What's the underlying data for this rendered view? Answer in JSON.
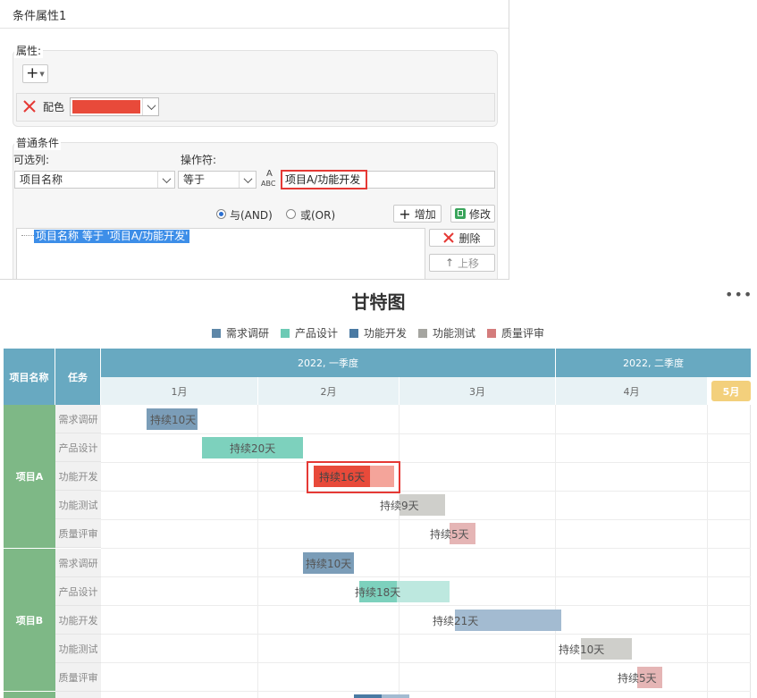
{
  "dialog": {
    "title": "条件属性1",
    "property_group": "属性:",
    "add_symbol": "+",
    "color_label": "配色",
    "condition_group": "普通条件",
    "column_label": "可选列:",
    "operator_label": "操作符:",
    "column_value": "项目名称",
    "operator_value": "等于",
    "value_input": "项目A/功能开发",
    "and_label": "与(AND)",
    "or_label": "或(OR)",
    "add_label": "增加",
    "modify_label": "修改",
    "delete_label": "删除",
    "move_up_label": "上移",
    "condition_item": "项目名称 等于 '项目A/功能开发'",
    "colors": {
      "selected_fill": "#e84a3a",
      "accent_red": "#e53935"
    }
  },
  "gantt": {
    "title": "甘特图",
    "more": "•••",
    "legend": [
      {
        "label": "需求调研",
        "color": "#5e87a8"
      },
      {
        "label": "产品设计",
        "color": "#6ccab5"
      },
      {
        "label": "功能开发",
        "color": "#4a7aa3"
      },
      {
        "label": "功能测试",
        "color": "#a5a5a0"
      },
      {
        "label": "质量评审",
        "color": "#d47c7c"
      }
    ],
    "header": {
      "project_col": "项目名称",
      "task_col": "任务",
      "quarters": [
        "2022, 一季度",
        "2022, 二季度"
      ],
      "months": [
        "1月",
        "2月",
        "3月",
        "4月",
        "5月"
      ]
    },
    "projects": [
      {
        "name": "项目A",
        "tasks": [
          "需求调研",
          "产品设计",
          "功能开发",
          "功能测试",
          "质量评审"
        ]
      },
      {
        "name": "项目B",
        "tasks": [
          "需求调研",
          "产品设计",
          "功能开发",
          "功能测试",
          "质量评审"
        ]
      }
    ],
    "bars": [
      {
        "label": "持续10天"
      },
      {
        "label": "持续20天"
      },
      {
        "label": "持续16天"
      },
      {
        "label": "持续9天"
      },
      {
        "label": "持续5天"
      },
      {
        "label": "持续10天"
      },
      {
        "label": "持续18天"
      },
      {
        "label": "持续21天"
      },
      {
        "label": "持续10天"
      },
      {
        "label": "持续5天"
      }
    ]
  }
}
